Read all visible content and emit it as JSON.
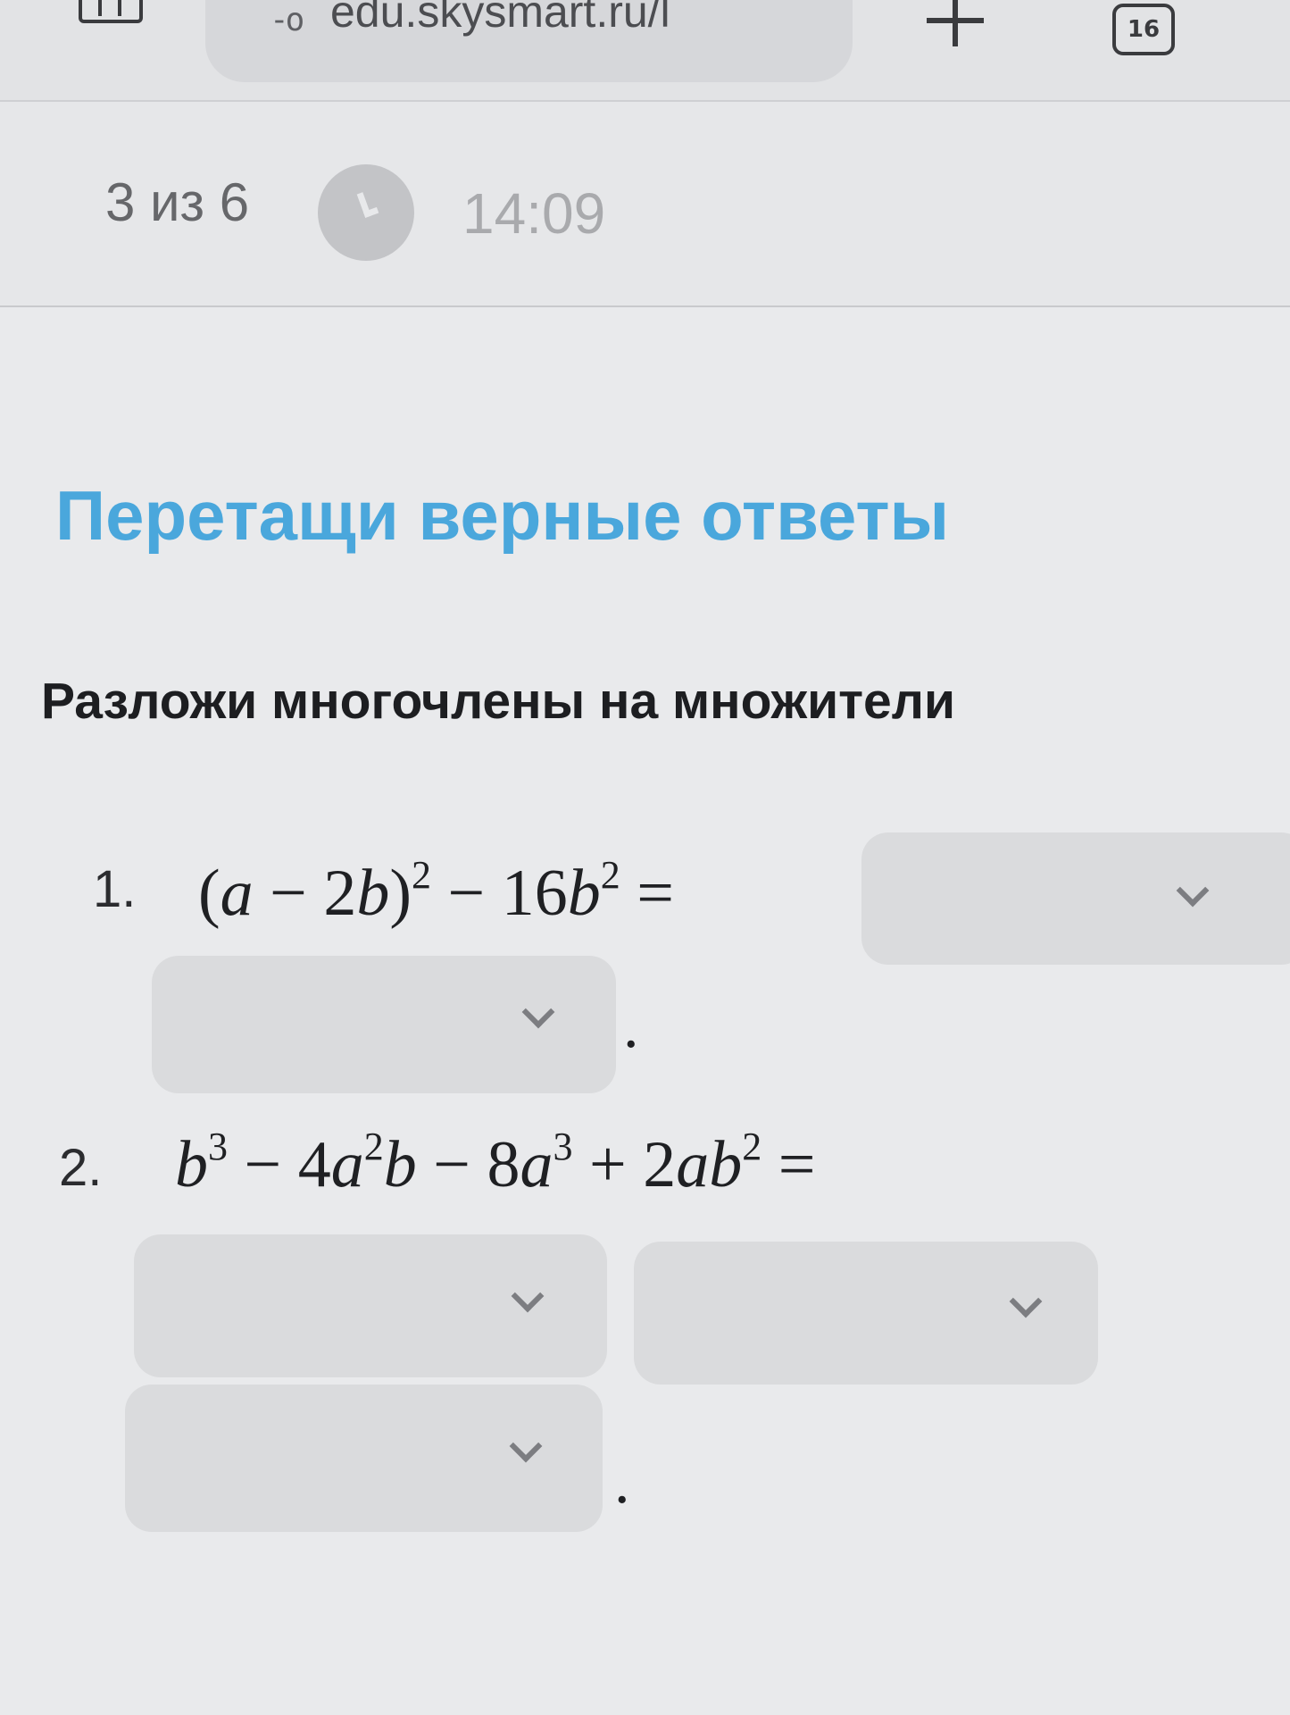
{
  "browser": {
    "url": "edu.skysmart.ru/l",
    "lock_icon": "-o",
    "tab_count": "16",
    "icons": [
      "tabs-grid-icon",
      "lock-icon",
      "new-tab-icon"
    ]
  },
  "progress": {
    "counter": "3 из 6",
    "timer": "14:09",
    "icon": "clock-icon"
  },
  "main": {
    "title": "Перетащи верные ответы",
    "instruction": "Разложи многочлены на множители"
  },
  "tasks": [
    {
      "number": "1.",
      "expression": "(a − 2b)² − 16b² =",
      "answer_slots": 2,
      "period": "."
    },
    {
      "number": "2.",
      "expression": "b³ − 4a²b − 8a³ + 2ab² =",
      "answer_slots": 3,
      "period": "."
    }
  ],
  "colors": {
    "accent": "#4aa7dc",
    "background": "#e9eaec",
    "dropdown": "#dadbdd"
  }
}
